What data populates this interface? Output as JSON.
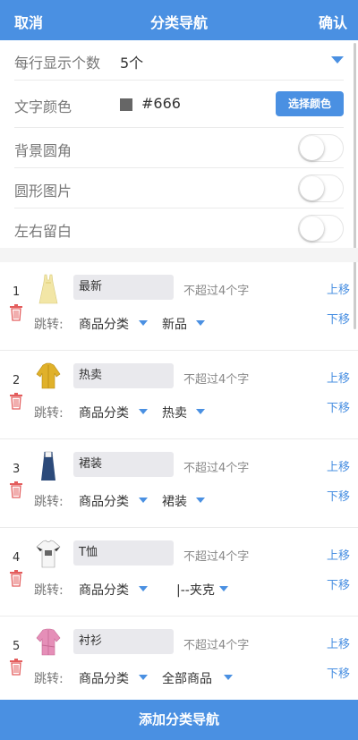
{
  "header": {
    "cancel": "取消",
    "title": "分类导航",
    "confirm": "确认"
  },
  "settings": {
    "per_row": {
      "label": "每行显示个数",
      "value": "5个"
    },
    "text_color": {
      "label": "文字颜色",
      "value": "#666",
      "button": "选择颜色"
    },
    "bg_radius": {
      "label": "背景圆角",
      "on": false
    },
    "round_image": {
      "label": "圆形图片",
      "on": false
    },
    "side_margin": {
      "label": "左右留白",
      "on": false
    }
  },
  "items": [
    {
      "index": "1",
      "name": "最新",
      "hint": "不超过4个字",
      "jump_label": "跳转:",
      "type": "商品分类",
      "category": "新品",
      "up": "上移",
      "down": "下移",
      "image": "dress-icon"
    },
    {
      "index": "2",
      "name": "热卖",
      "hint": "不超过4个字",
      "jump_label": "跳转:",
      "type": "商品分类",
      "category": "热卖",
      "up": "上移",
      "down": "下移",
      "image": "jacket-icon"
    },
    {
      "index": "3",
      "name": "裙装",
      "hint": "不超过4个字",
      "jump_label": "跳转:",
      "type": "商品分类",
      "category": "裙装",
      "up": "上移",
      "down": "下移",
      "image": "overall-dress-icon"
    },
    {
      "index": "4",
      "name": "T恤",
      "hint": "不超过4个字",
      "jump_label": "跳转:",
      "type": "商品分类",
      "category": "|--夹克",
      "up": "上移",
      "down": "下移",
      "image": "tshirt-icon"
    },
    {
      "index": "5",
      "name": "衬衫",
      "hint": "不超过4个字",
      "jump_label": "跳转:",
      "type": "商品分类",
      "category": "全部商品",
      "up": "上移",
      "down": "下移",
      "image": "shirt-icon"
    }
  ],
  "footer": {
    "add": "添加分类导航"
  },
  "colors": {
    "accent": "#4a90e2",
    "swatch": "#666666",
    "trash": "#e35d5d"
  }
}
